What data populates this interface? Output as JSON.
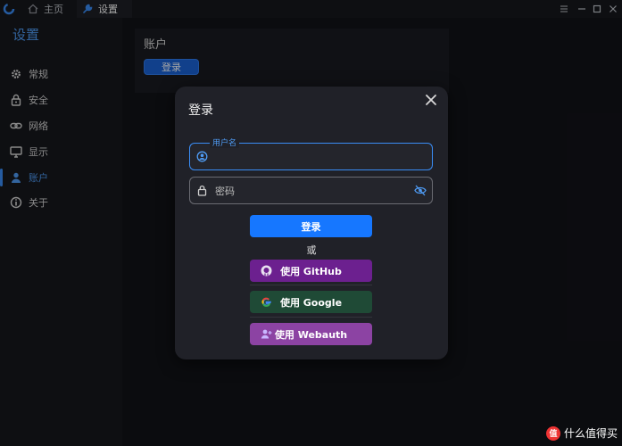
{
  "titlebar": {
    "tabs": [
      {
        "label": "主页",
        "icon": "home-icon"
      },
      {
        "label": "设置",
        "icon": "wrench-icon"
      }
    ],
    "controls": [
      "menu-icon",
      "minimize-icon",
      "maximize-icon",
      "close-icon"
    ]
  },
  "sidebar": {
    "title": "设置",
    "items": [
      {
        "label": "常规",
        "icon": "gear-icon"
      },
      {
        "label": "安全",
        "icon": "lock-icon"
      },
      {
        "label": "网络",
        "icon": "link-icon"
      },
      {
        "label": "显示",
        "icon": "monitor-icon"
      },
      {
        "label": "账户",
        "icon": "user-icon",
        "active": true
      },
      {
        "label": "关于",
        "icon": "info-icon"
      }
    ]
  },
  "main": {
    "title": "账户",
    "login_button": "登录"
  },
  "dialog": {
    "title": "登录",
    "username_legend": "用户名",
    "username_value": "",
    "password_placeholder": "密码",
    "login_button": "登录",
    "or_text": "或",
    "github_button": "使用 GitHub",
    "google_button": "使用 Google",
    "webauth_button": "使用 Webauth"
  },
  "watermark": {
    "logo": "值",
    "text": "什么值得买"
  },
  "colors": {
    "accent": "#1677ff",
    "github": "#6c208f",
    "google": "#1f4a36",
    "webauth": "#8c43a3"
  }
}
